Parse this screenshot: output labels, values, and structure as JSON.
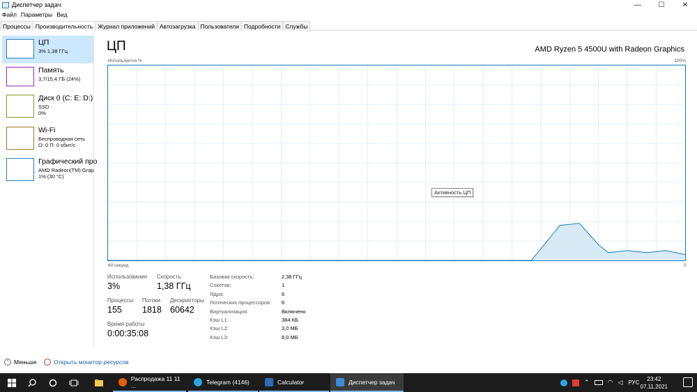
{
  "window": {
    "title": "Диспетчер задач",
    "minimize": "—",
    "maximize": "☐",
    "close": "✕"
  },
  "menu": [
    "Файл",
    "Параметры",
    "Вид"
  ],
  "tabs": [
    "Процессы",
    "Производительность",
    "Журнал приложений",
    "Автозагрузка",
    "Пользователи",
    "Подробности",
    "Службы"
  ],
  "sidebar": {
    "items": [
      {
        "title": "ЦП",
        "line1": "3%  1,38 ГГц",
        "line2": ""
      },
      {
        "title": "Память",
        "line1": "3,7/15,4 ГБ (24%)",
        "line2": ""
      },
      {
        "title": "Диск 0 (C: E: D:)",
        "line1": "SSD",
        "line2": "0%"
      },
      {
        "title": "Wi-Fi",
        "line1": "Беспроводная сеть",
        "line2": "О: 0 П: 0 кбит/с"
      },
      {
        "title": "Графический про",
        "line1": "AMD Radeon(TM) Grap",
        "line2": "1% (30 °C)"
      }
    ]
  },
  "main": {
    "title": "ЦП",
    "model": "AMD Ryzen 5 4500U with Radeon Graphics",
    "graph_top_left": "Используется %",
    "graph_top_right": "100%",
    "graph_bottom_left": "60 секунд",
    "graph_bottom_right": "0",
    "tooltip": "Активность ЦП"
  },
  "chart_data": {
    "type": "area",
    "x": [
      60,
      16,
      13,
      11,
      9,
      8,
      6,
      4,
      2,
      0
    ],
    "values": [
      0,
      0,
      18,
      19,
      8,
      4,
      5,
      4,
      5,
      3
    ],
    "ylim": [
      0,
      100
    ],
    "xlim": [
      60,
      0
    ],
    "grid": true,
    "color": "#117dbb",
    "fill": "#d9eaf7"
  },
  "stats": {
    "usage_label": "Использование",
    "usage_value": "3%",
    "speed_label": "Скорость",
    "speed_value": "1,38 ГГц",
    "processes_label": "Процессы",
    "processes_value": "155",
    "threads_label": "Потоки",
    "threads_value": "1818",
    "handles_label": "Дескрипторы",
    "handles_value": "60642",
    "uptime_label": "Время работы",
    "uptime_value": "0:00:35:08"
  },
  "specs": [
    {
      "label": "Базовая скорость:",
      "value": "2,38 ГГц"
    },
    {
      "label": "Сокетов:",
      "value": "1"
    },
    {
      "label": "Ядра:",
      "value": "6"
    },
    {
      "label": "Логических процессоров:",
      "value": "6"
    },
    {
      "label": "Виртуализация:",
      "value": "Включено"
    },
    {
      "label": "Кэш L1:",
      "value": "384 КБ"
    },
    {
      "label": "Кэш L2:",
      "value": "3,0 МБ"
    },
    {
      "label": "Кэш L3:",
      "value": "8,0 МБ"
    }
  ],
  "footer": {
    "less": "Меньше",
    "monitor": "Открыть монитор ресурсов"
  },
  "taskbar": {
    "apps": [
      {
        "label": "Распродажа 11 11 ...",
        "icon": "firefox-icon",
        "color": "#e66000"
      },
      {
        "label": "Telegram (4146)",
        "icon": "telegram-icon",
        "color": "#2ca5e0"
      },
      {
        "label": "Calculator",
        "icon": "calculator-icon",
        "color": "#2b6cb0"
      },
      {
        "label": "Диспетчер задач",
        "icon": "task-manager-icon",
        "color": "#3d8ad8"
      }
    ],
    "lang": "РУС",
    "time": "23:42",
    "date": "07.11.2021"
  }
}
